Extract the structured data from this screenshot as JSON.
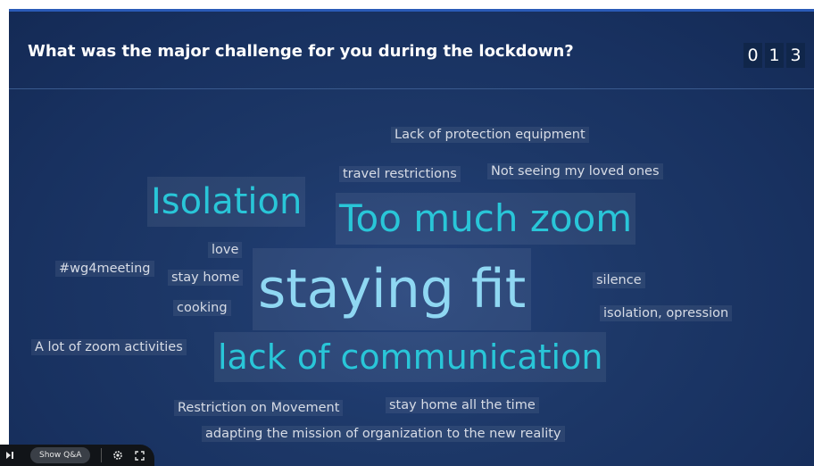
{
  "question": "What was the major challenge for you during the lockdown?",
  "counter": [
    "0",
    "1",
    "3"
  ],
  "words": [
    {
      "text": "Lack of protection equipment"
    },
    {
      "text": "travel restrictions"
    },
    {
      "text": "Not seeing my loved ones"
    },
    {
      "text": "Isolation"
    },
    {
      "text": "Too much zoom"
    },
    {
      "text": "love"
    },
    {
      "text": "#wg4meeting"
    },
    {
      "text": "stay home"
    },
    {
      "text": "staying fit"
    },
    {
      "text": "silence"
    },
    {
      "text": "cooking"
    },
    {
      "text": "isolation, opression"
    },
    {
      "text": "A lot of zoom activities"
    },
    {
      "text": "lack of communication"
    },
    {
      "text": "Restriction on Movement"
    },
    {
      "text": "stay home all the time"
    },
    {
      "text": "adapting the mission of organization to the new reality"
    }
  ],
  "controls": {
    "play_icon": "play-pause-icon",
    "show_qa_label": "Show Q&A",
    "settings_icon": "gear-icon",
    "fullscreen_icon": "fullscreen-icon"
  }
}
